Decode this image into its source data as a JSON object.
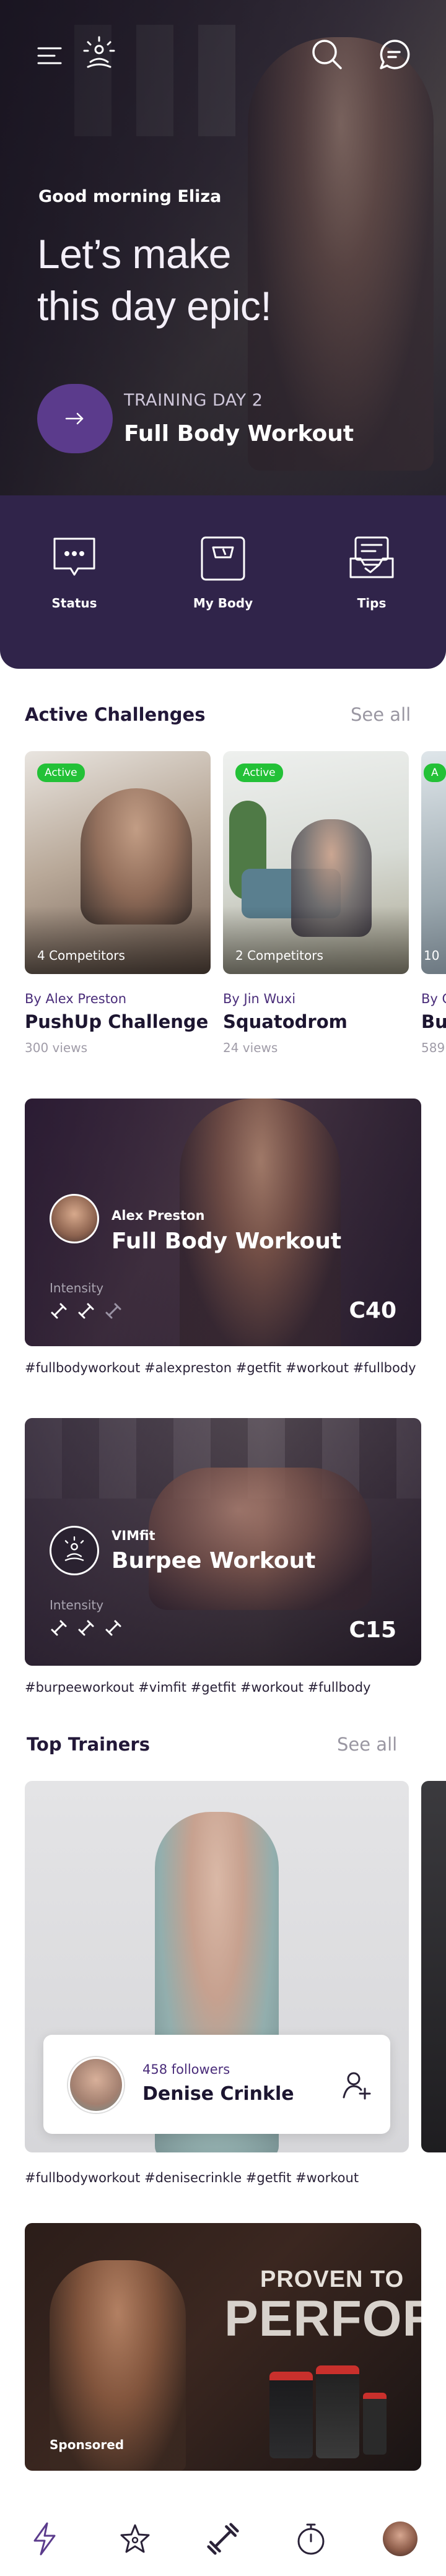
{
  "header": {
    "greeting": "Good morning Eliza",
    "headline_line1": "Let’s make",
    "headline_line2": "this day epic!",
    "training_day": "TRAINING DAY 2",
    "workout_name": "Full Body Workout"
  },
  "status_items": [
    {
      "label": "Status",
      "icon": "chat-dots-icon"
    },
    {
      "label": "My Body",
      "icon": "scale-icon"
    },
    {
      "label": "Tips",
      "icon": "clipboard-check-icon"
    }
  ],
  "active_challenges": {
    "title": "Active Challenges",
    "see_all": "See all",
    "items": [
      {
        "badge": "Active",
        "competitors": "4 Competitors",
        "author": "By Alex Preston",
        "title": "PushUp Challenge",
        "views": "300 views"
      },
      {
        "badge": "Active",
        "competitors": "2 Competitors",
        "author": "By Jin Wuxi",
        "title": "Squatodrom",
        "views": "24 views"
      },
      {
        "badge": "A",
        "competitors": "10",
        "author": "By C",
        "title": "Bur",
        "views": "589"
      }
    ]
  },
  "workouts": [
    {
      "trainer": "Alex Preston",
      "title": "Full Body Workout",
      "intensity_label": "Intensity",
      "code": "C40",
      "hashtags": "#fullbodyworkout #alexpreston #getfit #workout #fullbody"
    },
    {
      "trainer": "VIMfit",
      "title": "Burpee Workout",
      "intensity_label": "Intensity",
      "code": "C15",
      "hashtags": "#burpeeworkout #vimfit #getfit #workout #fullbody"
    }
  ],
  "top_trainers": {
    "title": "Top Trainers",
    "see_all": "See all",
    "trainer": {
      "followers": "458 followers",
      "name": "Denise Crinkle",
      "hashtags": "#fullbodyworkout #denisecrinkle #getfit #workout"
    }
  },
  "sponsored": {
    "label": "Sponsored",
    "line1": "PROVEN TO",
    "line2": "PERFORM"
  },
  "colors": {
    "brand_purple": "#30244a",
    "accent_purple": "#5b3b8c",
    "active_green": "#23c137"
  }
}
